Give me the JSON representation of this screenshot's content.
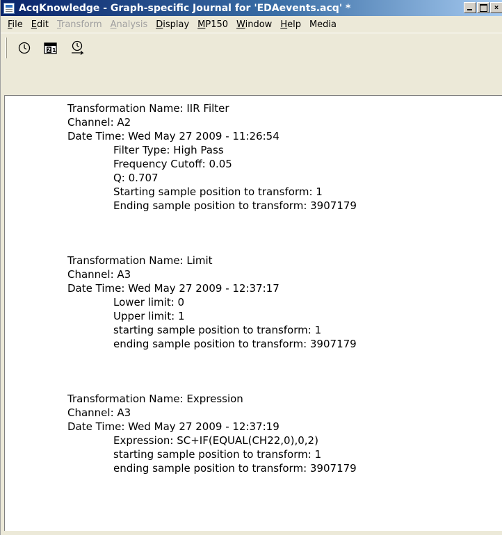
{
  "window": {
    "title": "AcqKnowledge - Graph-specific Journal for 'EDAevents.acq' *"
  },
  "menu": [
    {
      "label": "File",
      "mnemonic": "F",
      "rest": "ile",
      "disabled": false
    },
    {
      "label": "Edit",
      "mnemonic": "E",
      "rest": "dit",
      "disabled": false
    },
    {
      "label": "Transform",
      "mnemonic": "T",
      "rest": "ransform",
      "disabled": true
    },
    {
      "label": "Analysis",
      "mnemonic": "A",
      "rest": "nalysis",
      "disabled": true
    },
    {
      "label": "Display",
      "mnemonic": "D",
      "rest": "isplay",
      "disabled": false
    },
    {
      "label": "MP150",
      "mnemonic": "M",
      "rest": "P150",
      "disabled": false
    },
    {
      "label": "Window",
      "mnemonic": "W",
      "rest": "indow",
      "disabled": false
    },
    {
      "label": "Help",
      "mnemonic": "H",
      "rest": "elp",
      "disabled": false
    },
    {
      "label": "Media",
      "mnemonic": "",
      "rest": "Media",
      "disabled": false
    }
  ],
  "toolbar": {
    "buttons": [
      {
        "icon": "clock-icon"
      },
      {
        "icon": "calendar-icon"
      },
      {
        "icon": "clock-insert-icon"
      }
    ]
  },
  "journal": {
    "entries": [
      {
        "name": "Transformation Name: IIR Filter",
        "channel": "Channel: A2",
        "datetime": "Date Time: Wed May 27 2009 - 11:26:54",
        "details": [
          "Filter Type: High Pass",
          "Frequency Cutoff: 0.05",
          "Q: 0.707",
          "Starting sample position to transform: 1",
          "Ending sample position to transform: 3907179"
        ]
      },
      {
        "name": "Transformation Name: Limit",
        "channel": "Channel: A3",
        "datetime": "Date Time: Wed May 27 2009 - 12:37:17",
        "details": [
          "Lower limit: 0",
          "Upper limit: 1",
          "starting sample position to transform: 1",
          "ending sample position to transform: 3907179"
        ]
      },
      {
        "name": "Transformation Name: Expression",
        "channel": "Channel: A3",
        "datetime": "Date Time: Wed May 27 2009 - 12:37:19",
        "details": [
          "Expression: SC+IF(EQUAL(CH22,0),0,2)",
          "starting sample position to transform: 1",
          "ending sample position to transform: 3907179"
        ]
      }
    ]
  }
}
